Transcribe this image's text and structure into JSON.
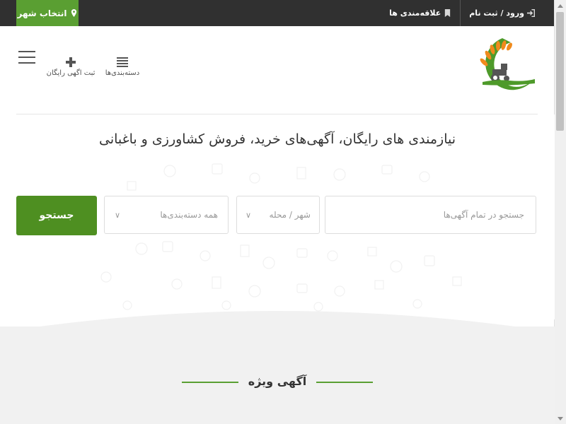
{
  "topbar": {
    "city_button": "انتخاب شهر",
    "login": "ورود / ثبت نام",
    "favorites": "علاقه‌مندی ها"
  },
  "header": {
    "nav_categories": "دسته‌بندی‌ها",
    "nav_post_ad": "ثبت اگهی رایگان"
  },
  "hero": {
    "title": "نیازمندی های رایگان، آگهی‌های خرید، فروش کشاورزی و باغبانی",
    "search": {
      "placeholder": "جستجو در تمام آگهی‌ها",
      "city_placeholder": "شهر / محله",
      "category_value": "همه دسته‌بندی‌ها",
      "button": "جستجو"
    }
  },
  "featured": {
    "title": "آگهی ویژه"
  },
  "colors": {
    "topbar": "#303030",
    "accent": "#5a9f32",
    "button": "#4e8f21",
    "logo_orange": "#f08a1c"
  },
  "icons": [
    "map-marker-icon",
    "sign-in-icon",
    "bookmark-icon",
    "plus-icon",
    "list-icon",
    "hamburger-icon",
    "chevron-down-icon",
    "tractor-logo"
  ]
}
